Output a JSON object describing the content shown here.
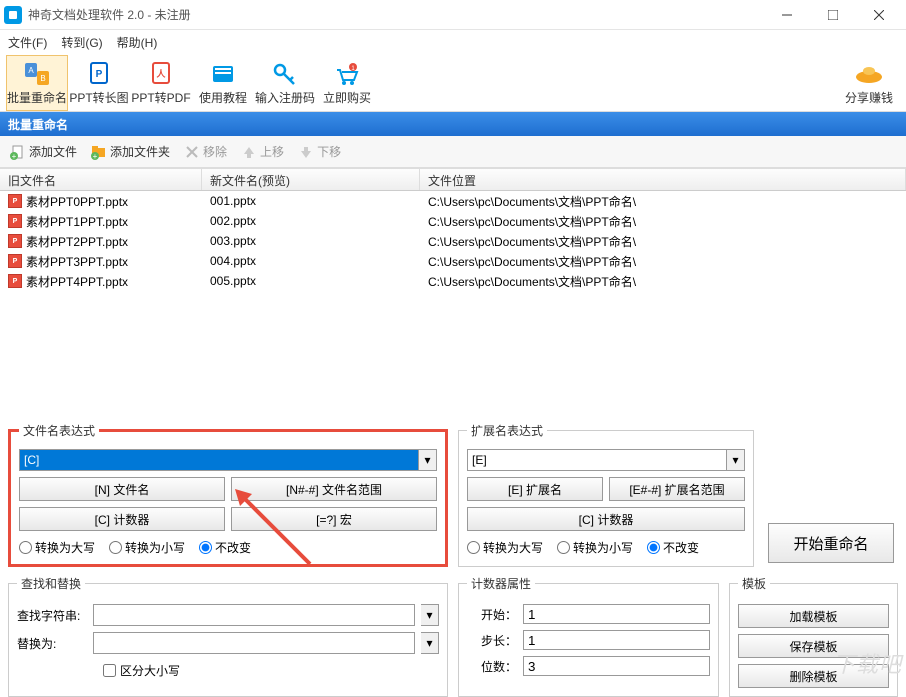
{
  "window": {
    "title": "神奇文档处理软件 2.0 - 未注册"
  },
  "menu": {
    "file": "文件(F)",
    "goto": "转到(G)",
    "help": "帮助(H)"
  },
  "toolbar": {
    "rename": "批量重命名",
    "ppt_long": "PPT转长图",
    "ppt_pdf": "PPT转PDF",
    "tutorial": "使用教程",
    "regcode": "输入注册码",
    "buy": "立即购买",
    "share": "分享赚钱"
  },
  "section": {
    "title": "批量重命名"
  },
  "actions": {
    "addfile": "添加文件",
    "addfolder": "添加文件夹",
    "remove": "移除",
    "up": "上移",
    "down": "下移"
  },
  "table": {
    "headers": {
      "old": "旧文件名",
      "new": "新文件名(预览)",
      "loc": "文件位置"
    },
    "rows": [
      {
        "old": "素材PPT0PPT.pptx",
        "new": "001.pptx",
        "loc": "C:\\Users\\pc\\Documents\\文档\\PPT命名\\"
      },
      {
        "old": "素材PPT1PPT.pptx",
        "new": "002.pptx",
        "loc": "C:\\Users\\pc\\Documents\\文档\\PPT命名\\"
      },
      {
        "old": "素材PPT2PPT.pptx",
        "new": "003.pptx",
        "loc": "C:\\Users\\pc\\Documents\\文档\\PPT命名\\"
      },
      {
        "old": "素材PPT3PPT.pptx",
        "new": "004.pptx",
        "loc": "C:\\Users\\pc\\Documents\\文档\\PPT命名\\"
      },
      {
        "old": "素材PPT4PPT.pptx",
        "new": "005.pptx",
        "loc": "C:\\Users\\pc\\Documents\\文档\\PPT命名\\"
      }
    ]
  },
  "expr": {
    "filename_legend": "文件名表达式",
    "filename_value": "[C]",
    "ext_legend": "扩展名表达式",
    "ext_value": "[E]",
    "btn_n": "[N] 文件名",
    "btn_nrange": "[N#-#] 文件名范围",
    "btn_c": "[C] 计数器",
    "btn_macro": "[=?] 宏",
    "btn_e": "[E] 扩展名",
    "btn_erange": "[E#-#] 扩展名范围",
    "btn_c2": "[C] 计数器",
    "radio_upper": "转换为大写",
    "radio_lower": "转换为小写",
    "radio_keep": "不改变"
  },
  "start_btn": "开始重命名",
  "findreplace": {
    "legend": "查找和替换",
    "find_label": "查找字符串:",
    "replace_label": "替换为:",
    "case": "区分大小写"
  },
  "counter": {
    "legend": "计数器属性",
    "start_label": "开始：",
    "start_value": "1",
    "step_label": "步长：",
    "step_value": "1",
    "digits_label": "位数：",
    "digits_value": "3"
  },
  "template": {
    "legend": "模板",
    "load": "加载模板",
    "save": "保存模板",
    "delete": "删除模板"
  },
  "watermark": "下载吧"
}
